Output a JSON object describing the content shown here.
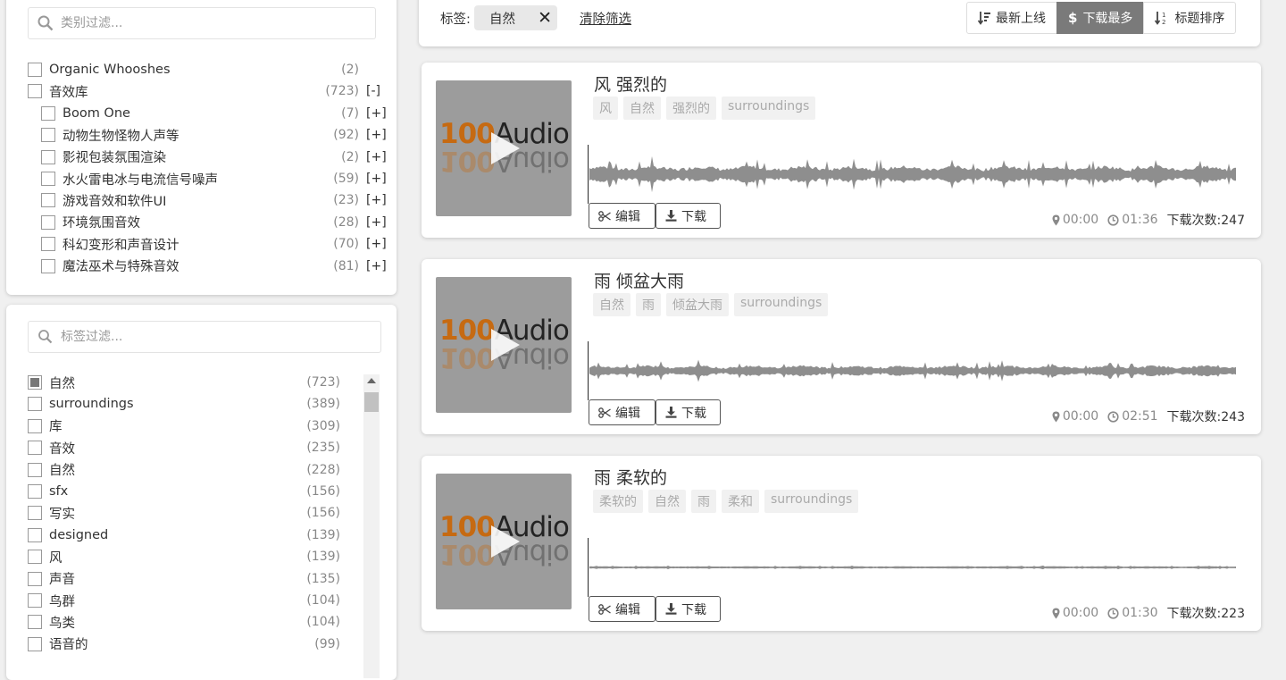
{
  "categories": {
    "search_placeholder": "类别过滤...",
    "items": [
      {
        "label": "Organic Whooshes",
        "count": "(2)",
        "expander": "",
        "indent": 0
      },
      {
        "label": "音效库",
        "count": "(723)",
        "expander": "[-]",
        "indent": 0
      },
      {
        "label": "Boom One",
        "count": "(7)",
        "expander": "[+]",
        "indent": 1
      },
      {
        "label": "动物生物怪物人声等",
        "count": "(92)",
        "expander": "[+]",
        "indent": 1
      },
      {
        "label": "影视包装氛围渲染",
        "count": "(2)",
        "expander": "[+]",
        "indent": 1
      },
      {
        "label": "水火雷电冰与电流信号噪声",
        "count": "(59)",
        "expander": "[+]",
        "indent": 1
      },
      {
        "label": "游戏音效和软件UI",
        "count": "(23)",
        "expander": "[+]",
        "indent": 1
      },
      {
        "label": "环境氛围音效",
        "count": "(28)",
        "expander": "[+]",
        "indent": 1
      },
      {
        "label": "科幻变形和声音设计",
        "count": "(70)",
        "expander": "[+]",
        "indent": 1
      },
      {
        "label": "魔法巫术与特殊音效",
        "count": "(81)",
        "expander": "[+]",
        "indent": 1
      }
    ]
  },
  "tags": {
    "search_placeholder": "标签过滤...",
    "items": [
      {
        "label": "自然",
        "count": "(723)",
        "checked": true
      },
      {
        "label": "surroundings",
        "count": "(389)",
        "checked": false
      },
      {
        "label": "库",
        "count": "(309)",
        "checked": false
      },
      {
        "label": "音效",
        "count": "(235)",
        "checked": false
      },
      {
        "label": "自然",
        "count": "(228)",
        "checked": false
      },
      {
        "label": "sfx",
        "count": "(156)",
        "checked": false
      },
      {
        "label": "写实",
        "count": "(156)",
        "checked": false
      },
      {
        "label": "designed",
        "count": "(139)",
        "checked": false
      },
      {
        "label": "风",
        "count": "(139)",
        "checked": false
      },
      {
        "label": "声音",
        "count": "(135)",
        "checked": false
      },
      {
        "label": "鸟群",
        "count": "(104)",
        "checked": false
      },
      {
        "label": "鸟类",
        "count": "(104)",
        "checked": false
      },
      {
        "label": "语音的",
        "count": "(99)",
        "checked": false
      }
    ]
  },
  "filter_bar": {
    "label": "标签:",
    "active_tag": "自然",
    "clear_label": "清除筛选",
    "sort": [
      {
        "label": "最新上线",
        "icon": "sort-desc-icon",
        "active": false
      },
      {
        "label": "下载最多",
        "icon": "dollar-icon",
        "active": true
      },
      {
        "label": "标题排序",
        "icon": "sort-alpha-icon",
        "active": false
      }
    ]
  },
  "sounds": [
    {
      "title": "风 强烈的",
      "tags": [
        "风",
        "自然",
        "强烈的",
        "surroundings"
      ],
      "position": "00:00",
      "duration": "01:36",
      "downloads": "下载次数:247",
      "edit_label": "编辑",
      "download_label": "下载",
      "wave_amp": 1.0
    },
    {
      "title": "雨 倾盆大雨",
      "tags": [
        "自然",
        "雨",
        "倾盆大雨",
        "surroundings"
      ],
      "position": "00:00",
      "duration": "02:51",
      "downloads": "下载次数:243",
      "edit_label": "编辑",
      "download_label": "下载",
      "wave_amp": 0.6
    },
    {
      "title": "雨 柔软的",
      "tags": [
        "柔软的",
        "自然",
        "雨",
        "柔和",
        "surroundings"
      ],
      "position": "00:00",
      "duration": "01:30",
      "downloads": "下载次数:223",
      "edit_label": "编辑",
      "download_label": "下载",
      "wave_amp": 0.08
    }
  ],
  "thumbnail": {
    "logo_num": "100",
    "logo_word": "Audio"
  },
  "colors": {
    "accent": "#7a7a7a",
    "logo_orange": "#c66a12",
    "wave": "#8e8e8e"
  }
}
